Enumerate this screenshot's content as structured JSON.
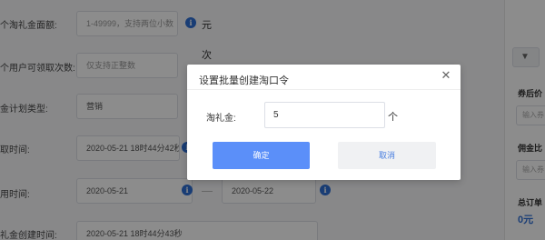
{
  "form": {
    "amount_label": "个淘礼金面额:",
    "amount_placeholder": "1-49999，支持两位小数",
    "amount_unit": "元",
    "per_user_label": "个用户可领取次数:",
    "per_user_placeholder": "仅支持正整数",
    "per_user_unit": "次",
    "plan_type_label": "金计划类型:",
    "plan_type_value": "营销",
    "claim_time_label": "取时间:",
    "claim_time_value": "2020-05-21 18时44分42秒",
    "use_time_label": "用时间:",
    "use_time_start": "2020-05-21",
    "use_time_end": "2020-05-22",
    "created_time_label": "礼金创建时间:",
    "created_time_value": "2020-05-21 18时44分43秒",
    "info_icon_glyph": "i"
  },
  "right_panel": {
    "filter_icon_glyph": "▼",
    "after_coupon_label": "券后价",
    "after_coupon_placeholder": "输入券",
    "commission_label": "佣金比",
    "commission_placeholder": "输入券",
    "total_order_label": "总订单",
    "total_value": "0元"
  },
  "dialog": {
    "title": "设置批量创建淘口令",
    "close_glyph": "✕",
    "field_label": "淘礼金:",
    "field_value": "5",
    "field_unit": "个",
    "confirm_label": "确定",
    "cancel_label": "取消"
  },
  "colors": {
    "primary": "#5b8ff9",
    "info": "#2f6fd6",
    "overlay": "rgba(0,0,0,0.45)"
  }
}
